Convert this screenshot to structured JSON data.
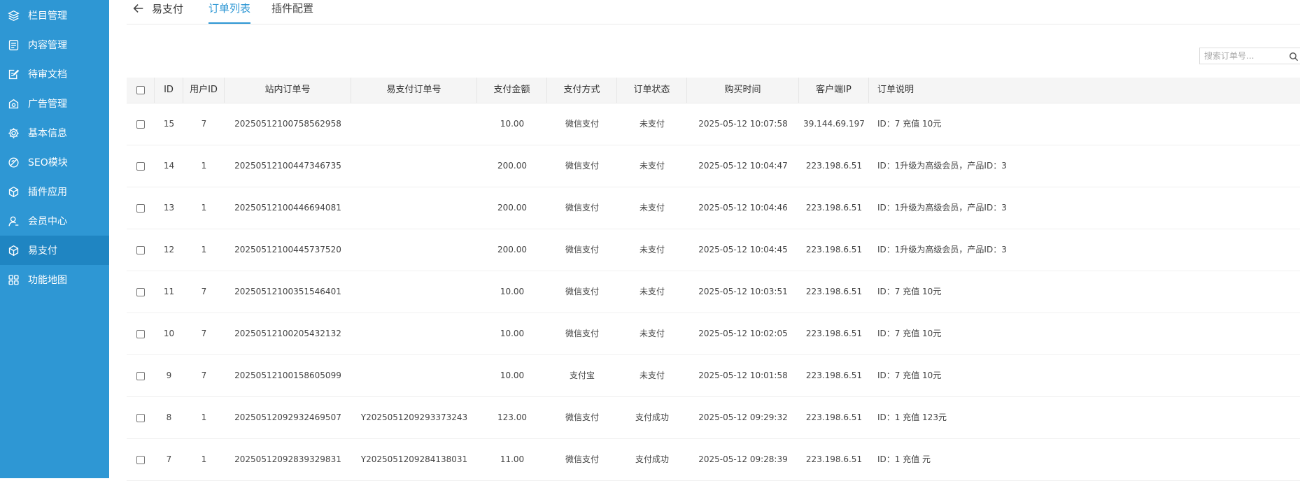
{
  "sidebar": {
    "items": [
      {
        "label": "栏目管理",
        "icon": "layers-icon"
      },
      {
        "label": "内容管理",
        "icon": "document-icon"
      },
      {
        "label": "待审文档",
        "icon": "edit-document-icon"
      },
      {
        "label": "广告管理",
        "icon": "ad-icon"
      },
      {
        "label": "基本信息",
        "icon": "gear-icon"
      },
      {
        "label": "SEO模块",
        "icon": "seo-icon"
      },
      {
        "label": "插件应用",
        "icon": "cube-icon"
      },
      {
        "label": "会员中心",
        "icon": "user-icon"
      },
      {
        "label": "易支付",
        "icon": "cube-icon"
      },
      {
        "label": "功能地图",
        "icon": "grid-icon"
      }
    ]
  },
  "header": {
    "back_label": "易支付",
    "tabs": [
      {
        "label": "订单列表"
      },
      {
        "label": "插件配置"
      }
    ]
  },
  "search": {
    "placeholder": "搜索订单号..."
  },
  "table": {
    "headers": [
      "ID",
      "用户ID",
      "站内订单号",
      "易支付订单号",
      "支付金额",
      "支付方式",
      "订单状态",
      "购买时间",
      "客户端IP",
      "订单说明"
    ],
    "rows": [
      {
        "id": "15",
        "uid": "7",
        "order_no": "20250512100758562958",
        "pay_no": "",
        "amount": "10.00",
        "method": "微信支付",
        "status": "未支付",
        "time": "2025-05-12 10:07:58",
        "ip": "39.144.69.197",
        "desc": "ID：7 充值 10元"
      },
      {
        "id": "14",
        "uid": "1",
        "order_no": "20250512100447346735",
        "pay_no": "",
        "amount": "200.00",
        "method": "微信支付",
        "status": "未支付",
        "time": "2025-05-12 10:04:47",
        "ip": "223.198.6.51",
        "desc": "ID：1升级为高级会员，产品ID：3"
      },
      {
        "id": "13",
        "uid": "1",
        "order_no": "20250512100446694081",
        "pay_no": "",
        "amount": "200.00",
        "method": "微信支付",
        "status": "未支付",
        "time": "2025-05-12 10:04:46",
        "ip": "223.198.6.51",
        "desc": "ID：1升级为高级会员，产品ID：3"
      },
      {
        "id": "12",
        "uid": "1",
        "order_no": "20250512100445737520",
        "pay_no": "",
        "amount": "200.00",
        "method": "微信支付",
        "status": "未支付",
        "time": "2025-05-12 10:04:45",
        "ip": "223.198.6.51",
        "desc": "ID：1升级为高级会员，产品ID：3"
      },
      {
        "id": "11",
        "uid": "7",
        "order_no": "20250512100351546401",
        "pay_no": "",
        "amount": "10.00",
        "method": "微信支付",
        "status": "未支付",
        "time": "2025-05-12 10:03:51",
        "ip": "223.198.6.51",
        "desc": "ID：7 充值 10元"
      },
      {
        "id": "10",
        "uid": "7",
        "order_no": "20250512100205432132",
        "pay_no": "",
        "amount": "10.00",
        "method": "微信支付",
        "status": "未支付",
        "time": "2025-05-12 10:02:05",
        "ip": "223.198.6.51",
        "desc": "ID：7 充值 10元"
      },
      {
        "id": "9",
        "uid": "7",
        "order_no": "20250512100158605099",
        "pay_no": "",
        "amount": "10.00",
        "method": "支付宝",
        "status": "未支付",
        "time": "2025-05-12 10:01:58",
        "ip": "223.198.6.51",
        "desc": "ID：7 充值 10元"
      },
      {
        "id": "8",
        "uid": "1",
        "order_no": "20250512092932469507",
        "pay_no": "Y2025051209293373243",
        "amount": "123.00",
        "method": "微信支付",
        "status": "支付成功",
        "time": "2025-05-12 09:29:32",
        "ip": "223.198.6.51",
        "desc": "ID：1 充值 123元"
      },
      {
        "id": "7",
        "uid": "1",
        "order_no": "20250512092839329831",
        "pay_no": "Y2025051209284138031",
        "amount": "11.00",
        "method": "微信支付",
        "status": "支付成功",
        "time": "2025-05-12 09:28:39",
        "ip": "223.198.6.51",
        "desc": "ID：1 充值 元"
      }
    ]
  }
}
